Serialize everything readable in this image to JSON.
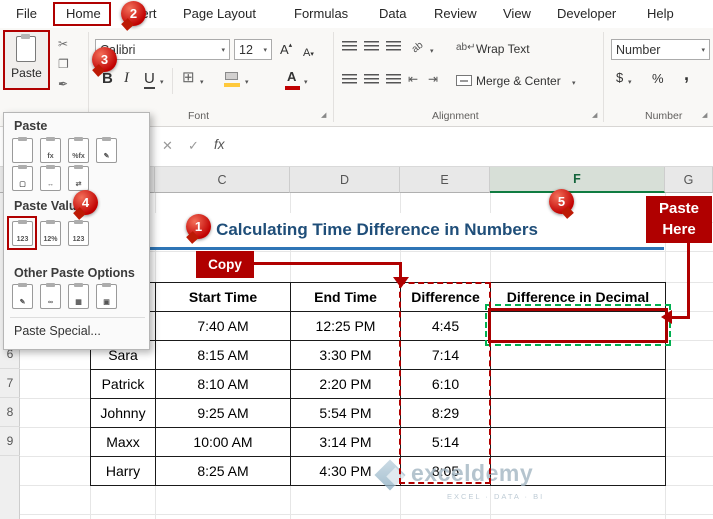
{
  "ribbon": {
    "tabs": [
      "File",
      "Home",
      "Insert",
      "Page Layout",
      "Formulas",
      "Data",
      "Review",
      "View",
      "Developer",
      "Help"
    ],
    "paste_button_label": "Paste",
    "font_name": "Calibri",
    "font_size": "12",
    "bold_label": "B",
    "italic_label": "I",
    "underline_label": "U",
    "font_color_label": "A",
    "wrap_text_label": "Wrap Text",
    "merge_center_label": "Merge & Center",
    "number_format_value": "Number",
    "currency_label": "$",
    "percent_label": "%",
    "comma_label": ",",
    "group_labels": {
      "font": "Font",
      "alignment": "Alignment",
      "number": "Number"
    },
    "icon_glyphs": {
      "cut": "✂",
      "copy": "❐",
      "format_painter": "✒"
    }
  },
  "formula_bar": {
    "cancel_glyph": "✕",
    "enter_glyph": "✓",
    "fx_label": "fx"
  },
  "paste_menu": {
    "titles": [
      "Paste",
      "Paste Values",
      "Other Paste Options"
    ],
    "paste_special_label": "Paste Special...",
    "row1_glyphs": [
      "",
      "fx",
      "%fx",
      "✎"
    ],
    "row2_glyphs": [
      "▢",
      "↔",
      "⇄"
    ],
    "row3_glyphs": [
      "123",
      "12%",
      "123"
    ],
    "row4_glyphs": [
      "✎",
      "∞",
      "▦",
      "▣"
    ]
  },
  "sheet": {
    "title": "Calculating Time Difference in Numbers",
    "col_headers": [
      "C",
      "D",
      "E",
      "F",
      "G"
    ],
    "row_headers": [
      "6",
      "7",
      "8",
      "9"
    ],
    "table": {
      "headers": [
        "",
        "Start Time",
        "End Time",
        "Difference",
        "Difference in Decimal"
      ],
      "rows": [
        [
          "",
          "7:40 AM",
          "12:25 PM",
          "4:45",
          ""
        ],
        [
          "Sara",
          "8:15 AM",
          "3:30 PM",
          "7:14",
          ""
        ],
        [
          "Patrick",
          "8:10 AM",
          "2:20 PM",
          "6:10",
          ""
        ],
        [
          "Johnny",
          "9:25 AM",
          "5:54 PM",
          "8:29",
          ""
        ],
        [
          "Maxx",
          "10:00 AM",
          "3:14 PM",
          "5:14",
          ""
        ],
        [
          "Harry",
          "8:25 AM",
          "4:30 PM",
          "8:05",
          ""
        ]
      ]
    }
  },
  "annotations": {
    "badges": [
      "1",
      "2",
      "3",
      "4",
      "5"
    ],
    "copy_label": "Copy",
    "paste_here_label": "Paste Here",
    "colors": {
      "annotation_red": "#B00000",
      "excel_green": "#107C41",
      "title_blue": "#1F4E79",
      "title_underline_blue": "#2E75B6",
      "marching_ants_green": "#00B050"
    }
  },
  "watermark": {
    "brand": "exceldemy",
    "tagline": "EXCEL · DATA · BI"
  }
}
